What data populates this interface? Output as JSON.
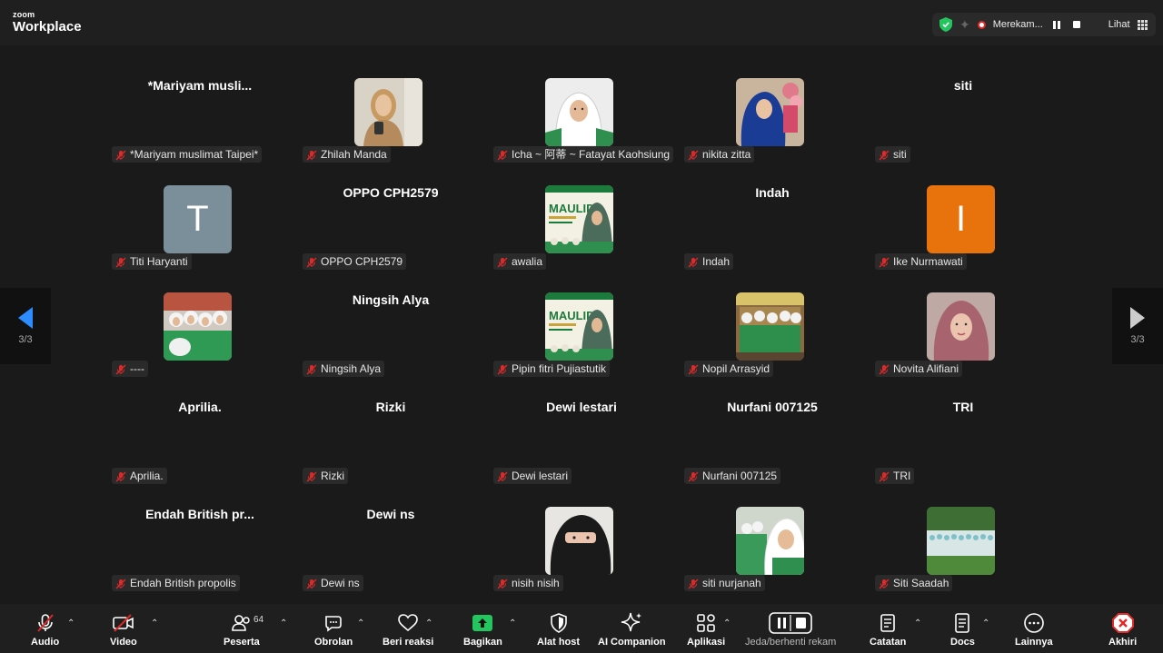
{
  "app": {
    "brand": "zoom",
    "product": "Workplace"
  },
  "status": {
    "recording_label": "Merekam...",
    "view_label": "Lihat"
  },
  "pagination": {
    "left": "3/3",
    "right": "3/3"
  },
  "participants": [
    {
      "display": "*Mariyam  musli...",
      "label": "*Mariyam muslimat Taipei*",
      "type": "name"
    },
    {
      "display": "",
      "label": "Zhilah Manda",
      "type": "photo",
      "photo": "photo-woman-beige"
    },
    {
      "display": "",
      "label": "Icha ~ 阿蒂 ~ Fatayat Kaohsiung",
      "type": "photo",
      "photo": "photo-woman-white-hijab"
    },
    {
      "display": "",
      "label": "nikita zitta",
      "type": "photo",
      "photo": "photo-woman-blue-hijab"
    },
    {
      "display": "siti",
      "label": "siti",
      "type": "name"
    },
    {
      "display": "T",
      "label": "Titi Haryanti",
      "type": "letter",
      "color": "#7a8f9a"
    },
    {
      "display": "OPPO CPH2579",
      "label": "OPPO CPH2579",
      "type": "name"
    },
    {
      "display": "",
      "label": "awalia",
      "type": "photo",
      "photo": "photo-maulid-poster"
    },
    {
      "display": "Indah",
      "label": "Indah",
      "type": "name"
    },
    {
      "display": "I",
      "label": "Ike Nurmawati",
      "type": "letter",
      "color": "#e8730c"
    },
    {
      "display": "",
      "label": "----",
      "type": "photo",
      "photo": "photo-group-green"
    },
    {
      "display": "Ningsih Alya",
      "label": "Ningsih Alya",
      "type": "name"
    },
    {
      "display": "",
      "label": "Pipin fitri Pujiastutik",
      "type": "photo",
      "photo": "photo-maulid-poster"
    },
    {
      "display": "",
      "label": "Nopil Arrasyid",
      "type": "photo",
      "photo": "photo-group-sitting"
    },
    {
      "display": "",
      "label": "Novita Alifiani",
      "type": "photo",
      "photo": "photo-woman-pink-hijab"
    },
    {
      "display": "Aprilia.",
      "label": "Aprilia.",
      "type": "name"
    },
    {
      "display": "Rizki",
      "label": "Rizki",
      "type": "name"
    },
    {
      "display": "Dewi lestari",
      "label": "Dewi lestari",
      "type": "name"
    },
    {
      "display": "Nurfani 007125",
      "label": "Nurfani 007125",
      "type": "name"
    },
    {
      "display": "TRI",
      "label": "TRI",
      "type": "name"
    },
    {
      "display": "Endah  British  pr...",
      "label": "Endah British propolis",
      "type": "name"
    },
    {
      "display": "Dewi ns",
      "label": "Dewi ns",
      "type": "name"
    },
    {
      "display": "",
      "label": "nisih nisih",
      "type": "photo",
      "photo": "photo-woman-niqab"
    },
    {
      "display": "",
      "label": "siti nurjanah",
      "type": "photo",
      "photo": "photo-woman-selfie-group"
    },
    {
      "display": "",
      "label": "Siti Saadah",
      "type": "photo",
      "photo": "photo-large-group-outdoor"
    }
  ],
  "toolbar": {
    "audio": "Audio",
    "video": "Video",
    "participants": "Peserta",
    "participants_count": "64",
    "chat": "Obrolan",
    "react": "Beri reaksi",
    "share": "Bagikan",
    "host_tools": "Alat host",
    "ai": "AI Companion",
    "apps": "Aplikasi",
    "record": "Jeda/berhenti rekam",
    "notes": "Catatan",
    "docs": "Docs",
    "more": "Lainnya",
    "end": "Akhiri"
  },
  "colors": {
    "accent": "#2d8cff",
    "end": "#e02828",
    "share": "#22c55e"
  }
}
